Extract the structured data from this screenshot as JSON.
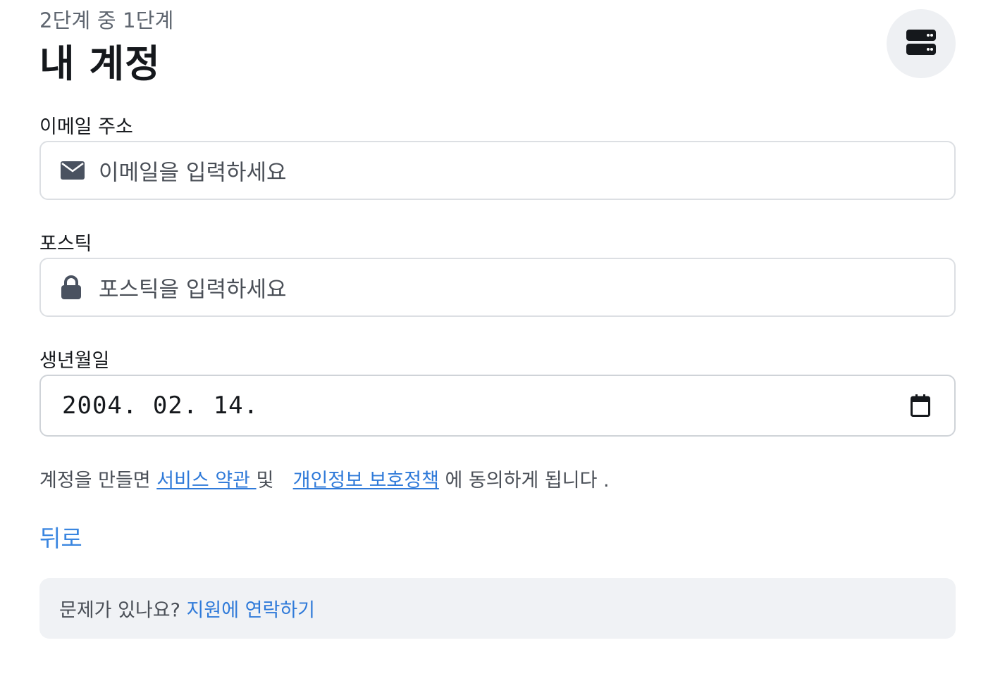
{
  "header": {
    "step_text": "2단계 중 1단계",
    "title": "내 계정",
    "server_icon": "server-icon"
  },
  "form": {
    "email": {
      "label": "이메일 주소",
      "placeholder": "이메일을 입력하세요",
      "icon": "envelope-icon"
    },
    "password": {
      "label": "포스틱",
      "placeholder": "포스틱을 입력하세요",
      "icon": "lock-icon"
    },
    "birthdate": {
      "label": "생년월일",
      "value": "2004. 02. 14.",
      "icon": "calendar-icon"
    }
  },
  "terms": {
    "prefix": "계정을 만들면",
    "terms_link": "서비스 약관 ",
    "conjunction": "및",
    "privacy_link": "개인정보 보호정책",
    "suffix": "에 동의하게 됩니다 ."
  },
  "back_label": "뒤로",
  "help": {
    "question": "문제가 있나요?",
    "link": "지원에 연락하기"
  },
  "colors": {
    "accent": "#2f7ad9",
    "help_bg": "#f0f2f5",
    "border": "#dcdfe3"
  }
}
